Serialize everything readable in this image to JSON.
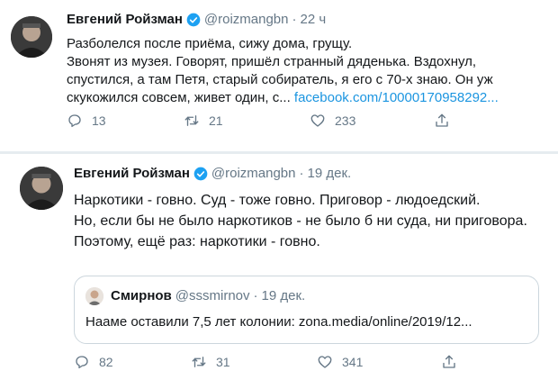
{
  "tweets": [
    {
      "name": "Евгений Ройзман",
      "handle": "@roizmangbn",
      "separator": "·",
      "time": "22 ч",
      "lines": [
        "Разболелся после приёма, сижу дома, грущу.",
        "Звонят из музея. Говорят, пришёл странный дяденька. Вздохнул,",
        "спустился, а там Петя, старый собиратель, я его с 70-х знаю. Он уж"
      ],
      "last_line_text": "скукожился совсем, живет один, с... ",
      "link": "facebook.com/10000170958292...",
      "replies": "13",
      "retweets": "21",
      "likes": "233"
    },
    {
      "name": "Евгений Ройзман",
      "handle": "@roizmangbn",
      "separator": "·",
      "time": "19 дек.",
      "lines": [
        "Наркотики - говно. Суд - тоже говно. Приговор - людоедский.",
        "Но, если бы не было наркотиков - не было б ни суда, ни приговора.",
        "Поэтому, ещё раз: наркотики - говно."
      ],
      "quote": {
        "name": "Смирнов",
        "handle": "@sssmirnov",
        "separator": "·",
        "time": "19 дек.",
        "text": "Нааме оставили 7,5 лет колонии: zona.media/online/2019/12..."
      },
      "replies": "82",
      "retweets": "31",
      "likes": "341"
    }
  ],
  "colors": {
    "text": "#14171a",
    "secondary": "#657786",
    "link": "#1b95e0",
    "verified": "#1da1f2",
    "border": "#ccd6dd"
  },
  "icons": [
    "reply-icon",
    "retweet-icon",
    "like-icon",
    "share-icon",
    "verified-badge-icon"
  ]
}
